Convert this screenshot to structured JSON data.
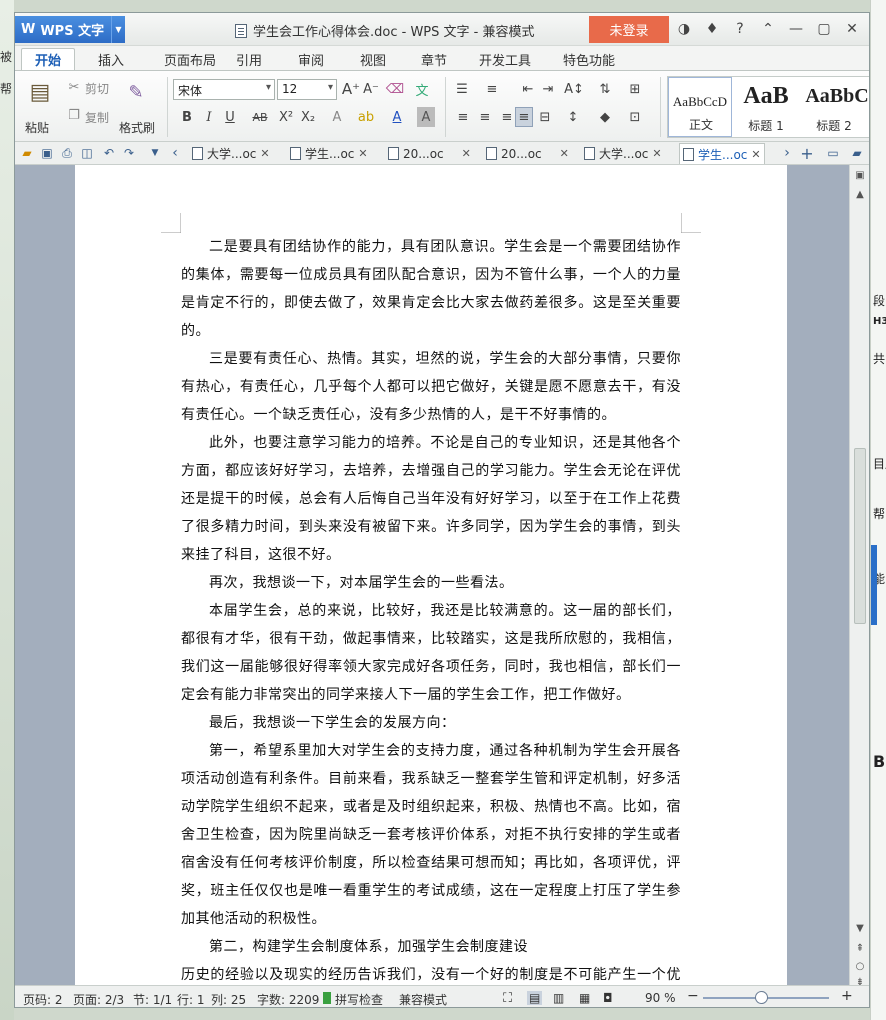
{
  "bg_left": [
    "被",
    "帮"
  ],
  "bg_right": [
    "段",
    "H3",
    "共",
    "目后",
    "帮",
    "能",
    "B"
  ],
  "app": {
    "menu_label": "WPS 文字",
    "title": "学生会工作心得体会.doc - WPS 文字 - 兼容模式",
    "login": "未登录"
  },
  "tabs": [
    "开始",
    "插入",
    "页面布局",
    "引用",
    "审阅",
    "视图",
    "章节",
    "开发工具",
    "特色功能"
  ],
  "ribbon": {
    "paste": "粘贴",
    "cut": "剪切",
    "copy": "复制",
    "format_painter": "格式刷",
    "font": "宋体",
    "size": "12",
    "styles": [
      {
        "sample": "AaBbCcD",
        "name": "正文"
      },
      {
        "sample": "AaB",
        "name": "标题 1"
      },
      {
        "sample": "AaBbC",
        "name": "标题 2"
      }
    ]
  },
  "doc_tabs": [
    "大学...oc",
    "学生...oc",
    "20...oc",
    "20...oc",
    "大学...oc",
    "学生...oc"
  ],
  "paragraphs": [
    "二是要具有团结协作的能力，具有团队意识。学生会是一个需要团结协作的集体，需要每一位成员具有团队配合意识，因为不管什么事，一个人的力量是肯定不行的，即使去做了，效果肯定会比大家去做药差很多。这是至关重要的。",
    "三是要有责任心、热情。其实，坦然的说，学生会的大部分事情，只要你有热心，有责任心，几乎每个人都可以把它做好，关键是愿不愿意去干，有没有责任心。一个缺乏责任心，没有多少热情的人，是干不好事情的。",
    "此外，也要注意学习能力的培养。不论是自己的专业知识，还是其他各个方面，都应该好好学习，去培养，去增强自己的学习能力。学生会无论在评优还是提干的时候，总会有人后悔自己当年没有好好学习，以至于在工作上花费了很多精力时间，到头来没有被留下来。许多同学，因为学生会的事情，到头来挂了科目，这很不好。",
    "再次，我想谈一下，对本届学生会的一些看法。",
    "本届学生会，总的来说，比较好，我还是比较满意的。这一届的部长们，都很有才华，很有干劲，做起事情来，比较踏实，这是我所欣慰的，我相信，我们这一届能够很好得率领大家完成好各项任务，同时，我也相信，部长们一定会有能力非常突出的同学来接人下一届的学生会工作，把工作做好。",
    "最后，我想谈一下学生会的发展方向：",
    "第一，希望系里加大对学生会的支持力度，通过各种机制为学生会开展各项活动创造有利条件。目前来看，我系缺乏一整套学生管和评定机制，好多活动学院学生组织不起来，或者是及时组织起来，积极、热情也不高。比如，宿舍卫生检查，因为院里尚缺乏一套考核评价体系，对拒不执行安排的学生或者宿舍没有任何考核评价制度，所以检查结果可想而知；再比如，各项评优，评奖，班主任仅仅也是唯一看重学生的考试成绩，这在一定程度上打压了学生参加其他活动的积极性。",
    "第二，构建学生会制度体系，加强学生会制度建设",
    "历史的经验以及现实的经历告诉我们，没有一个好的制度是不可能产生一个优秀的团队组织。所谓国有国法，家有家规，我们学生会就应该有自己的规章制度。"
  ],
  "status": {
    "page": "页码: 2",
    "pages": "页面: 2/3",
    "section": "节: 1/1",
    "row": "行: 1",
    "col": "列: 25",
    "words": "字数: 2209",
    "spell": "拼写检查",
    "mode": "兼容模式",
    "zoom": "90 %"
  },
  "colors": {
    "accent": "#2d6cc6",
    "login": "#e86a4a",
    "docbg": "#a3aebd"
  }
}
